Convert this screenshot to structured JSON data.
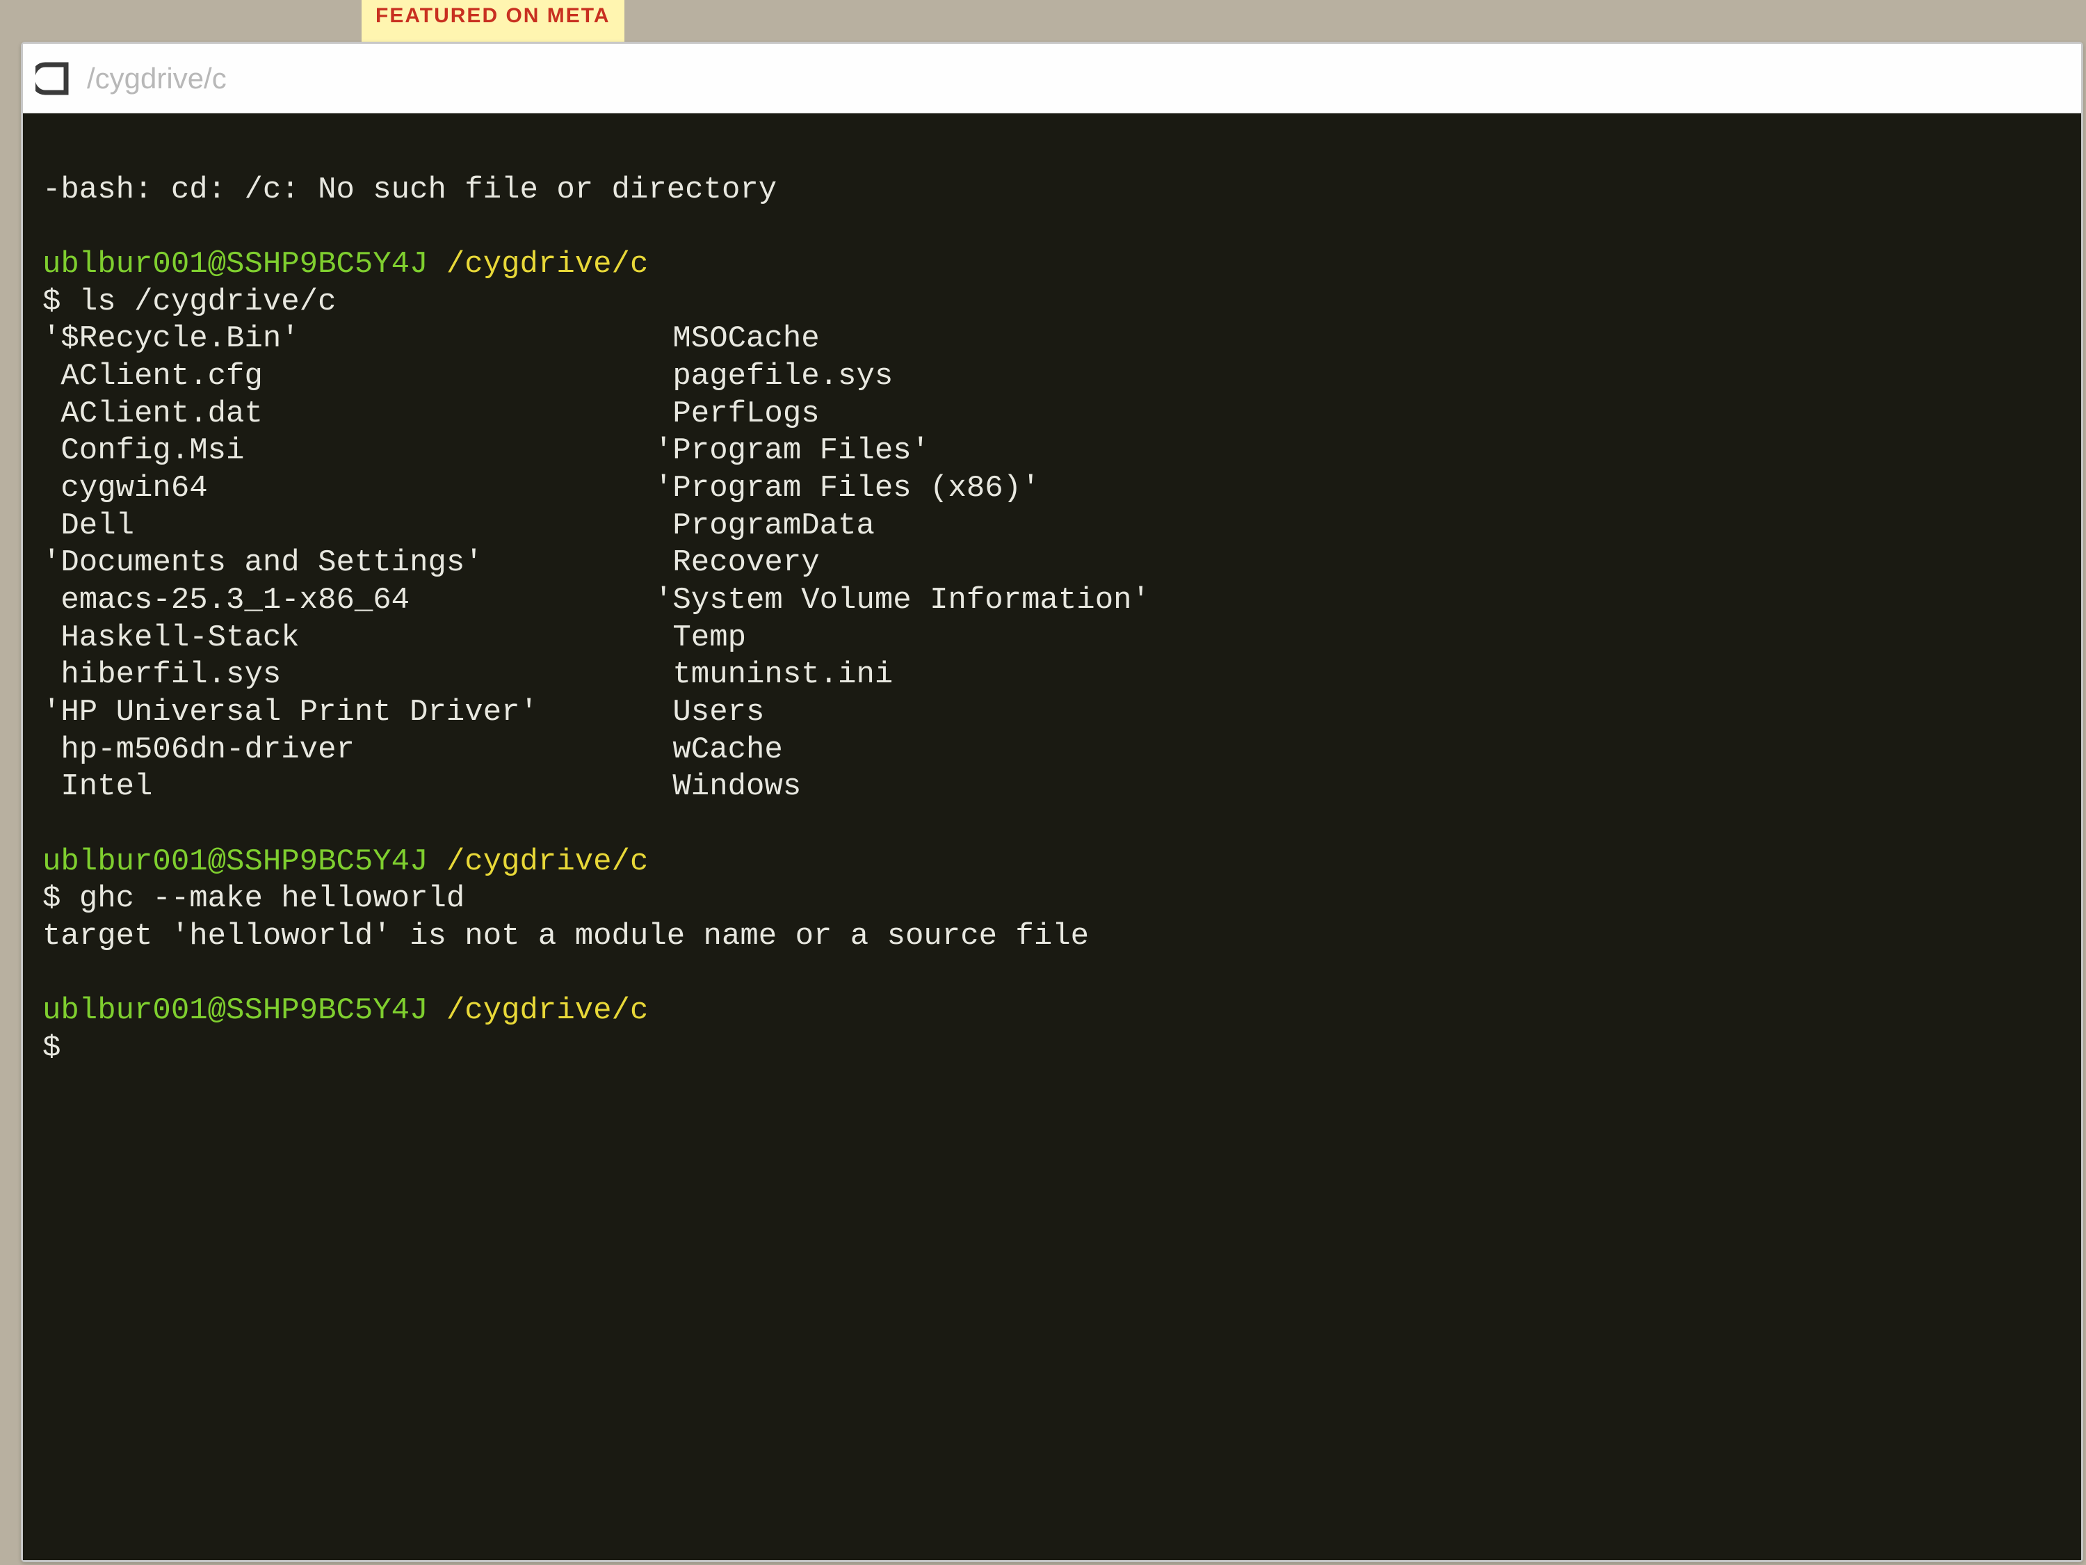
{
  "backdrop_banner": "FEATURED ON META",
  "window": {
    "title": "/cygdrive/c"
  },
  "terminal": {
    "error_line": "-bash: cd: /c: No such file or directory",
    "prompt1": {
      "user_host": "ublbur001@SSHP9BC5Y4J",
      "path": "/cygdrive/c",
      "cmd_sym": "$",
      "cmd": "ls /cygdrive/c"
    },
    "ls_col1": [
      "'$Recycle.Bin'",
      " AClient.cfg",
      " AClient.dat",
      " Config.Msi",
      " cygwin64",
      " Dell",
      "'Documents and Settings'",
      " emacs-25.3_1-x86_64",
      " Haskell-Stack",
      " hiberfil.sys",
      "'HP Universal Print Driver'",
      " hp-m506dn-driver",
      " Intel"
    ],
    "ls_col2": [
      " MSOCache",
      " pagefile.sys",
      " PerfLogs",
      "'Program Files'",
      "'Program Files (x86)'",
      " ProgramData",
      " Recovery",
      "'System Volume Information'",
      " Temp",
      " tmuninst.ini",
      " Users",
      " wCache",
      " Windows"
    ],
    "prompt2": {
      "user_host": "ublbur001@SSHP9BC5Y4J",
      "path": "/cygdrive/c",
      "cmd_sym": "$",
      "cmd": "ghc --make helloworld",
      "output": "target 'helloworld' is not a module name or a source file"
    },
    "prompt3": {
      "user_host": "ublbur001@SSHP9BC5Y4J",
      "path": "/cygdrive/c",
      "cmd_sym": "$"
    }
  }
}
